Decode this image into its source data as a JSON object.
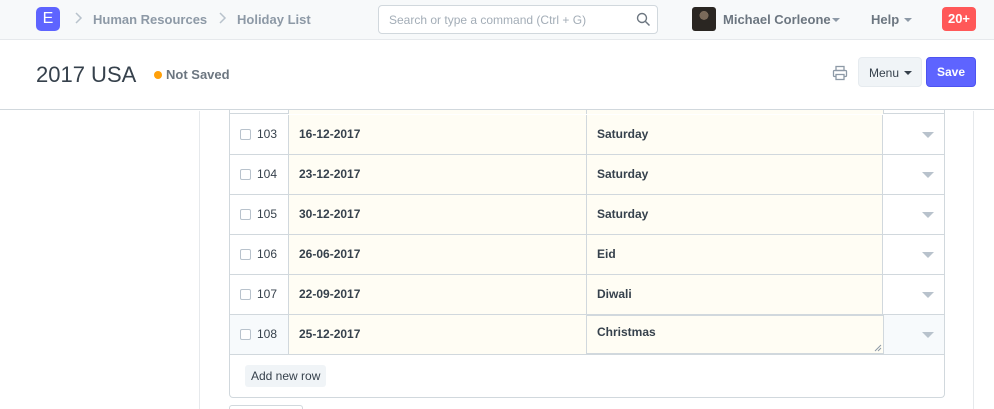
{
  "navbar": {
    "logo_letter": "E",
    "breadcrumbs": [
      "Human Resources",
      "Holiday List"
    ],
    "search_placeholder": "Search or type a command (Ctrl + G)",
    "user_name": "Michael Corleone",
    "help_label": "Help",
    "notification_count": "20+"
  },
  "page": {
    "title": "2017 USA",
    "status": "Not Saved",
    "menu_label": "Menu",
    "save_label": "Save"
  },
  "holidays": {
    "rows": [
      {
        "idx": "103",
        "date": "16-12-2017",
        "description": "Saturday"
      },
      {
        "idx": "104",
        "date": "23-12-2017",
        "description": "Saturday"
      },
      {
        "idx": "105",
        "date": "30-12-2017",
        "description": "Saturday"
      },
      {
        "idx": "106",
        "date": "26-06-2017",
        "description": "Eid"
      },
      {
        "idx": "107",
        "date": "22-09-2017",
        "description": "Diwali"
      },
      {
        "idx": "108",
        "date": "25-12-2017",
        "description": "Christmas"
      }
    ],
    "add_row_label": "Add new row"
  },
  "colors": {
    "accent": "#5e64ff",
    "status_dot": "#ffa00a",
    "badge": "#ff5858",
    "editable_cell": "#fffdf4"
  }
}
